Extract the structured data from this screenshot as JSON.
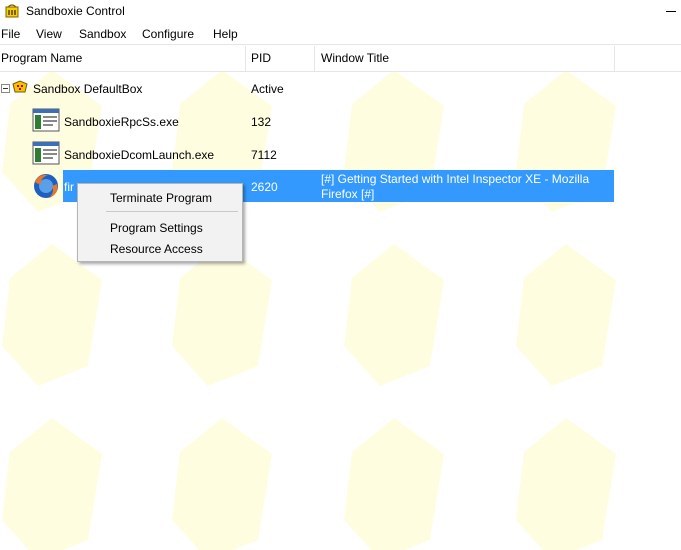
{
  "window": {
    "title": "Sandboxie Control",
    "watermark_color": "#fffde0"
  },
  "menu": [
    "File",
    "View",
    "Sandbox",
    "Configure",
    "Help"
  ],
  "columns": {
    "program_name": "Program Name",
    "pid": "PID",
    "window_title": "Window Title"
  },
  "tree": {
    "sandbox": {
      "name": "Sandbox DefaultBox",
      "status": "Active"
    },
    "processes": [
      {
        "name": "SandboxieRpcSs.exe",
        "pid": "132",
        "window_title": "",
        "icon": "exe-window-icon"
      },
      {
        "name": "SandboxieDcomLaunch.exe",
        "pid": "7112",
        "window_title": "",
        "icon": "exe-window-icon"
      },
      {
        "name": "firefox.exe",
        "visible_name": "fir",
        "pid": "2620",
        "window_title_line1": "[#] Getting Started with Intel Inspector XE - Mozilla",
        "window_title_line2": "Firefox [#]",
        "icon": "firefox-icon",
        "selected": true
      }
    ]
  },
  "context_menu": {
    "items": [
      "Terminate Program",
      "Program Settings",
      "Resource Access"
    ]
  },
  "colors": {
    "selection": "#3399ff",
    "context_bg": "#f2f2f2"
  }
}
